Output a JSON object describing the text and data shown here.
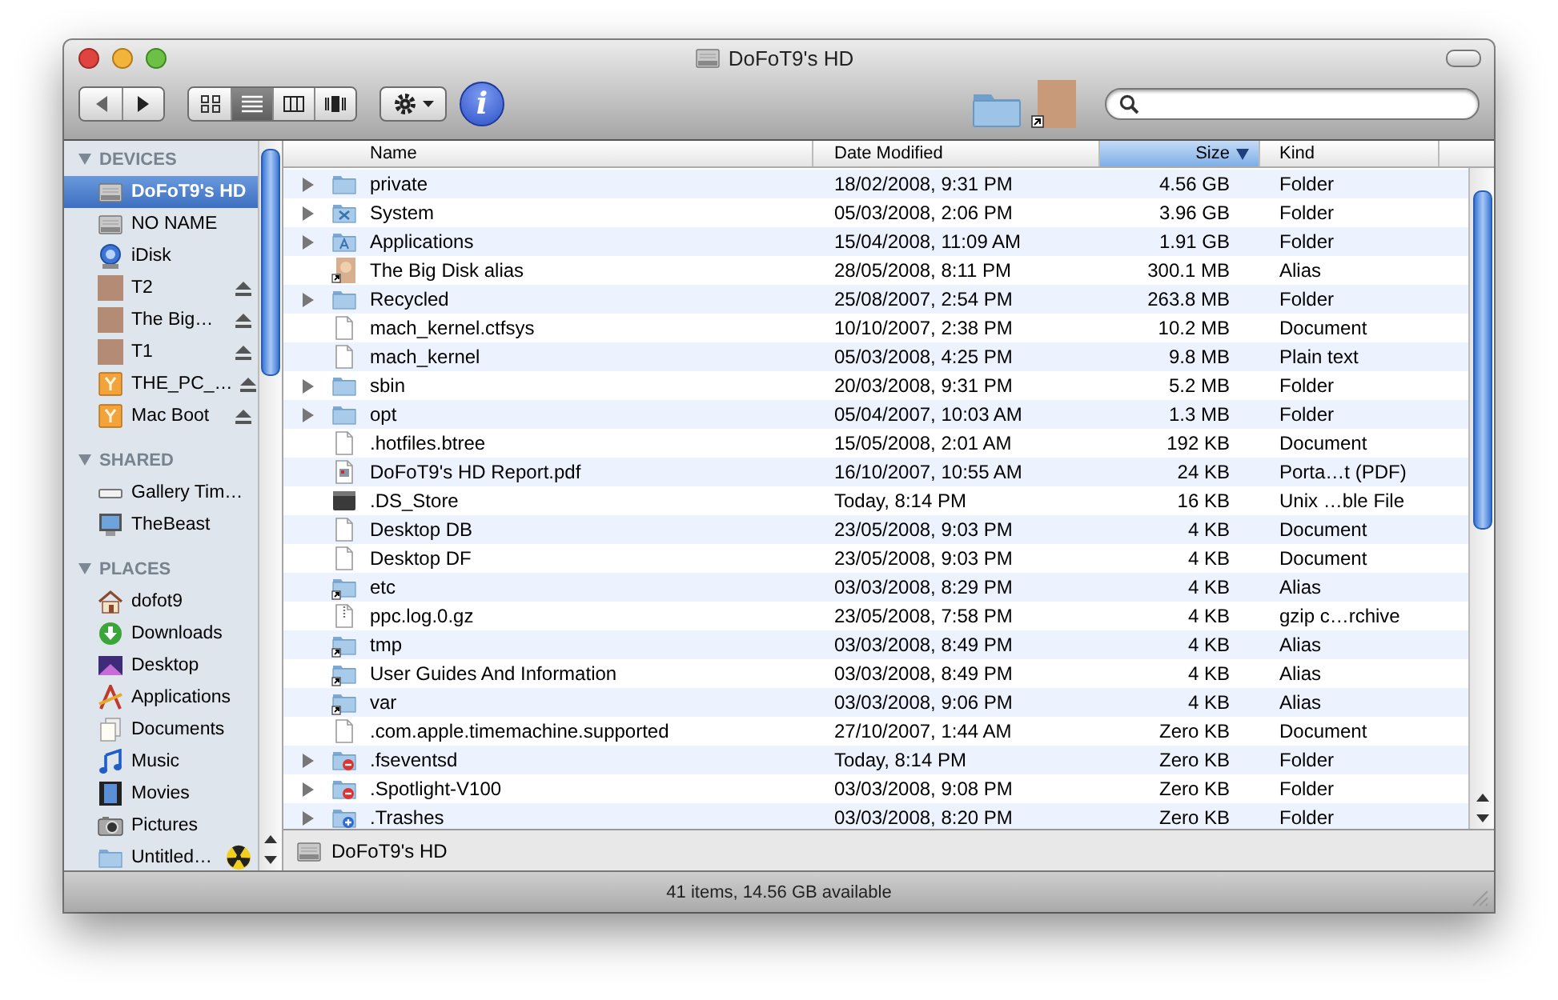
{
  "window": {
    "title": "DoFoT9's HD"
  },
  "toolbar": {
    "view_buttons": [
      {
        "kind": "icon",
        "selected": false
      },
      {
        "kind": "list",
        "selected": true
      },
      {
        "kind": "columns",
        "selected": false
      },
      {
        "kind": "coverflow",
        "selected": false
      }
    ],
    "info_glyph": "i"
  },
  "sidebar": {
    "sections": [
      {
        "title": "DEVICES",
        "expanded": true,
        "items": [
          {
            "label": "DoFoT9's HD",
            "kind": "disk",
            "selected": true,
            "ejectable": false
          },
          {
            "label": "NO NAME",
            "kind": "disk",
            "selected": false,
            "ejectable": false
          },
          {
            "label": "iDisk",
            "kind": "idisk",
            "selected": false,
            "ejectable": false
          },
          {
            "label": "T2",
            "kind": "photo",
            "selected": false,
            "ejectable": true
          },
          {
            "label": "The Big…",
            "kind": "photo",
            "selected": false,
            "ejectable": true
          },
          {
            "label": "T1",
            "kind": "photo",
            "selected": false,
            "ejectable": true
          },
          {
            "label": "THE_PC_…",
            "kind": "drive",
            "selected": false,
            "ejectable": true
          },
          {
            "label": "Mac Boot",
            "kind": "drive",
            "selected": false,
            "ejectable": true
          }
        ]
      },
      {
        "title": "SHARED",
        "expanded": true,
        "items": [
          {
            "label": "Gallery Tim…",
            "kind": "network",
            "selected": false,
            "ejectable": false
          },
          {
            "label": "TheBeast",
            "kind": "monitor",
            "selected": false,
            "ejectable": false
          }
        ]
      },
      {
        "title": "PLACES",
        "expanded": true,
        "items": [
          {
            "label": "dofot9",
            "kind": "home",
            "selected": false,
            "ejectable": false
          },
          {
            "label": "Downloads",
            "kind": "downloads",
            "selected": false,
            "ejectable": false
          },
          {
            "label": "Desktop",
            "kind": "desktop",
            "selected": false,
            "ejectable": false
          },
          {
            "label": "Applications",
            "kind": "applications",
            "selected": false,
            "ejectable": false
          },
          {
            "label": "Documents",
            "kind": "documents",
            "selected": false,
            "ejectable": false
          },
          {
            "label": "Music",
            "kind": "music",
            "selected": false,
            "ejectable": false
          },
          {
            "label": "Movies",
            "kind": "movies",
            "selected": false,
            "ejectable": false
          },
          {
            "label": "Pictures",
            "kind": "pictures",
            "selected": false,
            "ejectable": false
          },
          {
            "label": "Untitled…",
            "kind": "burnfolder",
            "selected": false,
            "ejectable": false
          }
        ]
      }
    ]
  },
  "table": {
    "columns": [
      {
        "label": "Name",
        "sorted": false
      },
      {
        "label": "Date Modified",
        "sorted": false
      },
      {
        "label": "Size",
        "sorted": true
      },
      {
        "label": "Kind",
        "sorted": false
      }
    ],
    "rows": [
      {
        "name": "private",
        "date": "18/02/2008, 9:31 PM",
        "size": "4.56 GB",
        "file_kind": "Folder",
        "kind": "folder",
        "expandable": true
      },
      {
        "name": "System",
        "date": "05/03/2008, 2:06 PM",
        "size": "3.96 GB",
        "file_kind": "Folder",
        "kind": "system",
        "expandable": true
      },
      {
        "name": "Applications",
        "date": "15/04/2008, 11:09 AM",
        "size": "1.91 GB",
        "file_kind": "Folder",
        "kind": "apps",
        "expandable": true
      },
      {
        "name": "The Big Disk alias",
        "date": "28/05/2008, 8:11 PM",
        "size": "300.1 MB",
        "file_kind": "Alias",
        "kind": "photoalias",
        "expandable": false
      },
      {
        "name": "Recycled",
        "date": "25/08/2007, 2:54 PM",
        "size": "263.8 MB",
        "file_kind": "Folder",
        "kind": "folder",
        "expandable": true
      },
      {
        "name": "mach_kernel.ctfsys",
        "date": "10/10/2007, 2:38 PM",
        "size": "10.2 MB",
        "file_kind": "Document",
        "kind": "document",
        "expandable": false
      },
      {
        "name": "mach_kernel",
        "date": "05/03/2008, 4:25 PM",
        "size": "9.8 MB",
        "file_kind": "Plain text",
        "kind": "document",
        "expandable": false
      },
      {
        "name": "sbin",
        "date": "20/03/2008, 9:31 PM",
        "size": "5.2 MB",
        "file_kind": "Folder",
        "kind": "folder",
        "expandable": true
      },
      {
        "name": "opt",
        "date": "05/04/2007, 10:03 AM",
        "size": "1.3 MB",
        "file_kind": "Folder",
        "kind": "folder",
        "expandable": true
      },
      {
        "name": ".hotfiles.btree",
        "date": "15/05/2008, 2:01 AM",
        "size": "192 KB",
        "file_kind": "Document",
        "kind": "document",
        "expandable": false
      },
      {
        "name": "DoFoT9's HD Report.pdf",
        "date": "16/10/2007, 10:55 AM",
        "size": "24 KB",
        "file_kind": "Porta…t (PDF)",
        "kind": "pdf",
        "expandable": false
      },
      {
        "name": ".DS_Store",
        "date": "Today, 8:14 PM",
        "size": "16 KB",
        "file_kind": "Unix …ble File",
        "kind": "exec",
        "expandable": false
      },
      {
        "name": "Desktop DB",
        "date": "23/05/2008, 9:03 PM",
        "size": "4 KB",
        "file_kind": "Document",
        "kind": "document",
        "expandable": false
      },
      {
        "name": "Desktop DF",
        "date": "23/05/2008, 9:03 PM",
        "size": "4 KB",
        "file_kind": "Document",
        "kind": "document",
        "expandable": false
      },
      {
        "name": "etc",
        "date": "03/03/2008, 8:29 PM",
        "size": "4 KB",
        "file_kind": "Alias",
        "kind": "aliasfolder",
        "expandable": false
      },
      {
        "name": "ppc.log.0.gz",
        "date": "23/05/2008, 7:58 PM",
        "size": "4 KB",
        "file_kind": "gzip c…rchive",
        "kind": "archive",
        "expandable": false
      },
      {
        "name": "tmp",
        "date": "03/03/2008, 8:49 PM",
        "size": "4 KB",
        "file_kind": "Alias",
        "kind": "aliasfolder",
        "expandable": false
      },
      {
        "name": "User Guides And Information",
        "date": "03/03/2008, 8:49 PM",
        "size": "4 KB",
        "file_kind": "Alias",
        "kind": "aliasfolder",
        "expandable": false
      },
      {
        "name": "var",
        "date": "03/03/2008, 9:06 PM",
        "size": "4 KB",
        "file_kind": "Alias",
        "kind": "aliasfolder",
        "expandable": false
      },
      {
        "name": ".com.apple.timemachine.supported",
        "date": "27/10/2007, 1:44 AM",
        "size": "Zero KB",
        "file_kind": "Document",
        "kind": "document",
        "expandable": false
      },
      {
        "name": ".fseventsd",
        "date": "Today, 8:14 PM",
        "size": "Zero KB",
        "file_kind": "Folder",
        "kind": "restricted",
        "expandable": true
      },
      {
        "name": ".Spotlight-V100",
        "date": "03/03/2008, 9:08 PM",
        "size": "Zero KB",
        "file_kind": "Folder",
        "kind": "restricted",
        "expandable": true
      },
      {
        "name": ".Trashes",
        "date": "03/03/2008, 8:20 PM",
        "size": "Zero KB",
        "file_kind": "Folder",
        "kind": "dropbox",
        "expandable": true
      }
    ]
  },
  "path_bar": {
    "label": "DoFoT9's HD"
  },
  "status_bar": "41 items, 14.56 GB available"
}
